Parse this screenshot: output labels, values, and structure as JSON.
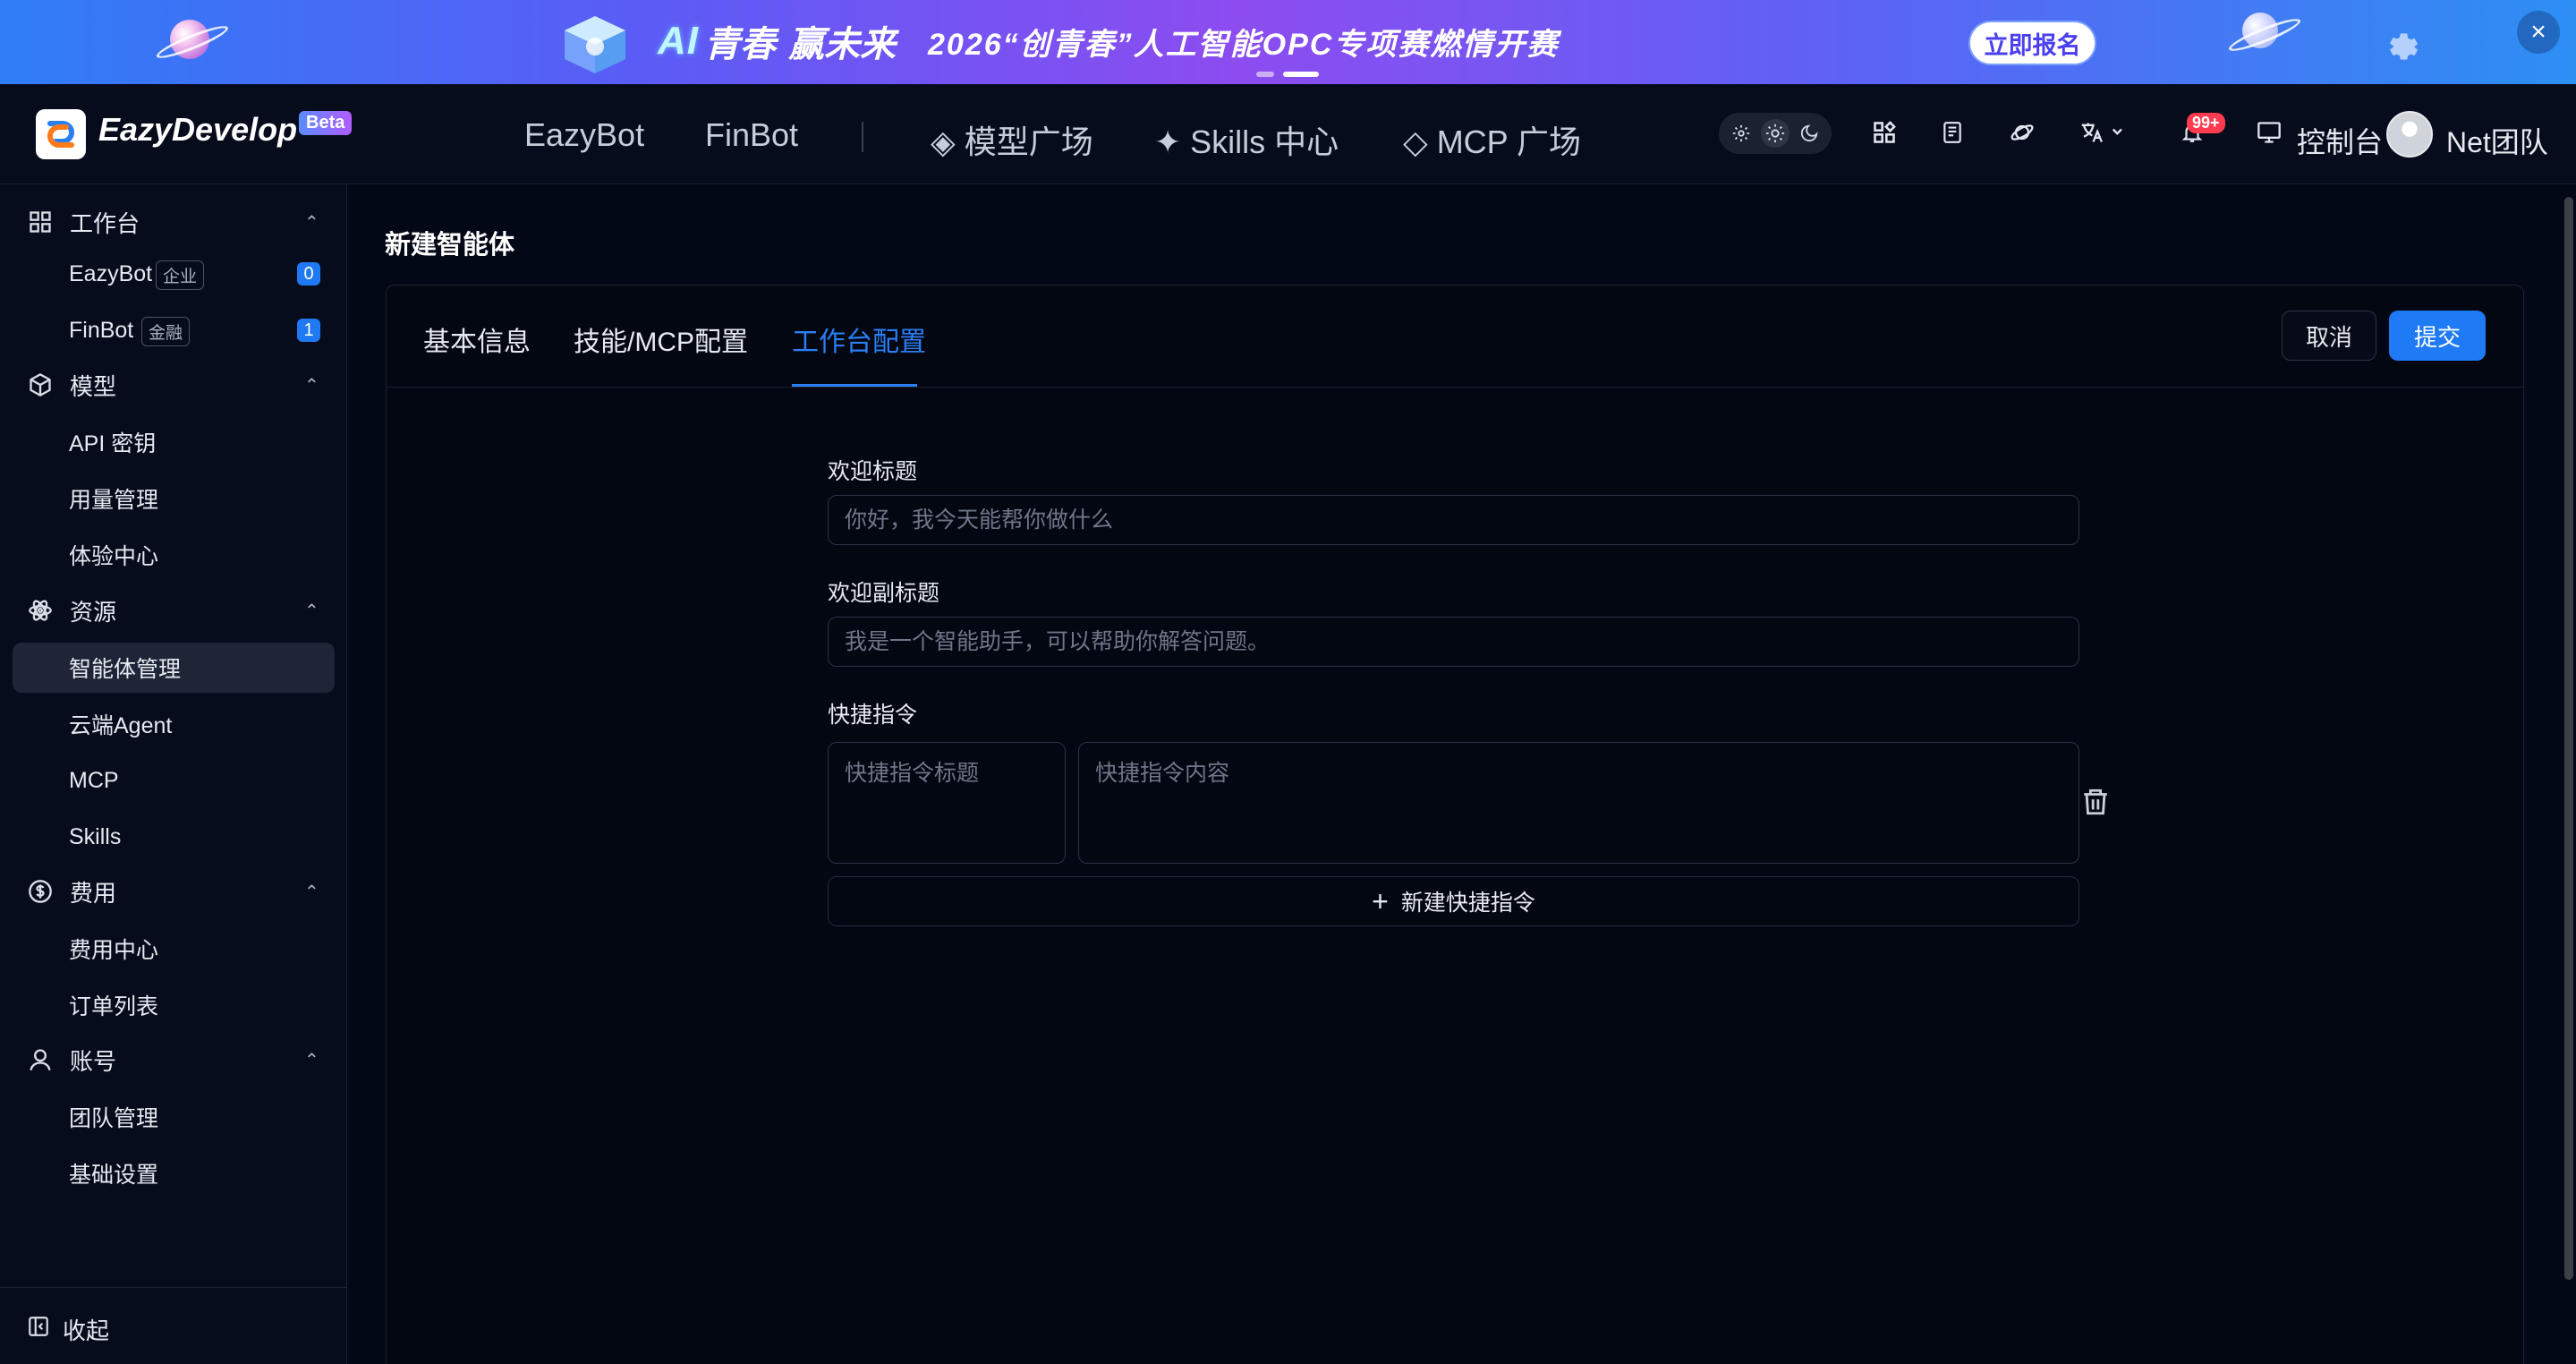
{
  "banner": {
    "ai_text": "AI",
    "youth_text": "青春",
    "win_text": "赢未来",
    "main_text": "2026“创青春”人工智能OPC专项赛燃情开赛",
    "signup_label": "立即报名",
    "close_label": "×"
  },
  "nav": {
    "brand": "EazyDevelop",
    "beta": "Beta",
    "links": [
      "EazyBot",
      "FinBot",
      "◈ 模型广场",
      "✦ Skills 中心",
      "◇ MCP 广场"
    ],
    "notification_badge": "99+",
    "console": "控制台",
    "team": "Net团队"
  },
  "sidebar": {
    "groups": [
      {
        "label": "工作台",
        "icon": "grid-icon",
        "chevron": "⌃"
      },
      {
        "label": "模型",
        "icon": "cube-icon",
        "chevron": "⌃"
      },
      {
        "label": "资源",
        "icon": "atom-icon",
        "chevron": "⌃"
      },
      {
        "label": "费用",
        "icon": "dollar-icon",
        "chevron": "⌃"
      },
      {
        "label": "账号",
        "icon": "user-icon",
        "chevron": "⌃"
      }
    ],
    "items": [
      {
        "label": "EazyBot",
        "tag": "企业",
        "count": "0"
      },
      {
        "label": "FinBot",
        "tag": "金融",
        "count": "1"
      },
      {
        "label": "API 密钥"
      },
      {
        "label": "用量管理"
      },
      {
        "label": "体验中心"
      },
      {
        "label": "智能体管理",
        "active": true
      },
      {
        "label": "云端Agent"
      },
      {
        "label": "MCP"
      },
      {
        "label": "Skills"
      },
      {
        "label": "费用中心"
      },
      {
        "label": "订单列表"
      },
      {
        "label": "团队管理"
      },
      {
        "label": "基础设置"
      }
    ],
    "collapse_label": "收起"
  },
  "main": {
    "page_title": "新建智能体",
    "tabs": [
      {
        "label": "基本信息"
      },
      {
        "label": "技能/MCP配置"
      },
      {
        "label": "工作台配置",
        "active": true
      }
    ],
    "cancel_label": "取消",
    "submit_label": "提交",
    "form": {
      "welcome_title_label": "欢迎标题",
      "welcome_title_placeholder": "你好，我今天能帮你做什么",
      "welcome_title_value": "",
      "welcome_subtitle_label": "欢迎副标题",
      "welcome_subtitle_placeholder": "我是一个智能助手，可以帮助你解答问题。",
      "welcome_subtitle_value": "",
      "shortcut_label": "快捷指令",
      "shortcut_title_placeholder": "快捷指令标题",
      "shortcut_content_placeholder": "快捷指令内容",
      "add_shortcut_label": "新建快捷指令"
    }
  },
  "colors": {
    "accent": "#1f7af5",
    "background": "#030816",
    "badge_red": "#ff3b4f"
  }
}
